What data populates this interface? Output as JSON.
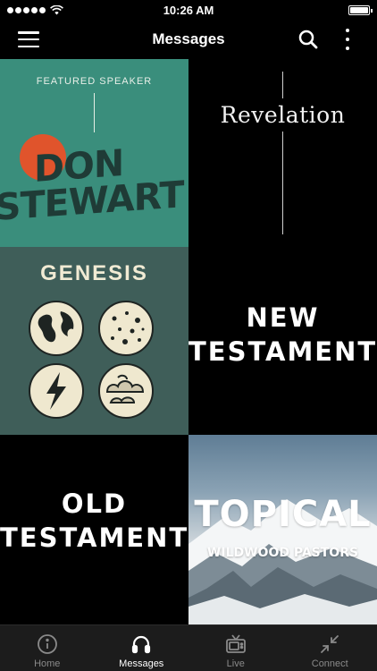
{
  "status_bar": {
    "time": "10:26 AM"
  },
  "header": {
    "title": "Messages",
    "menu_icon": "hamburger-menu-icon",
    "search_icon": "search-icon",
    "more_icon": "more-vertical-icon"
  },
  "tiles": {
    "featured": {
      "kicker": "FEATURED SPEAKER",
      "name_line1": "DON",
      "name_line2": "STEWART"
    },
    "revelation": {
      "title": "Revelation"
    },
    "genesis": {
      "title": "GENESIS"
    },
    "new_testament": {
      "line1": "NEW",
      "line2": "TESTAMENT"
    },
    "old_testament": {
      "line1": "OLD",
      "line2": "TESTAMENT"
    },
    "topical": {
      "title": "TOPICAL",
      "subtitle": "WILDWOOD PASTORS"
    }
  },
  "tab_bar": {
    "items": [
      {
        "label": "Home",
        "icon": "info-icon",
        "active": false
      },
      {
        "label": "Messages",
        "icon": "headphones-icon",
        "active": true
      },
      {
        "label": "Live",
        "icon": "tv-icon",
        "active": false
      },
      {
        "label": "Connect",
        "icon": "collapse-arrows-icon",
        "active": false
      }
    ]
  },
  "colors": {
    "featured_bg": "#3a8e7c",
    "genesis_bg": "#3f5e59",
    "accent_orange": "#e0542c",
    "tabbar_bg": "#1c1c1c"
  }
}
